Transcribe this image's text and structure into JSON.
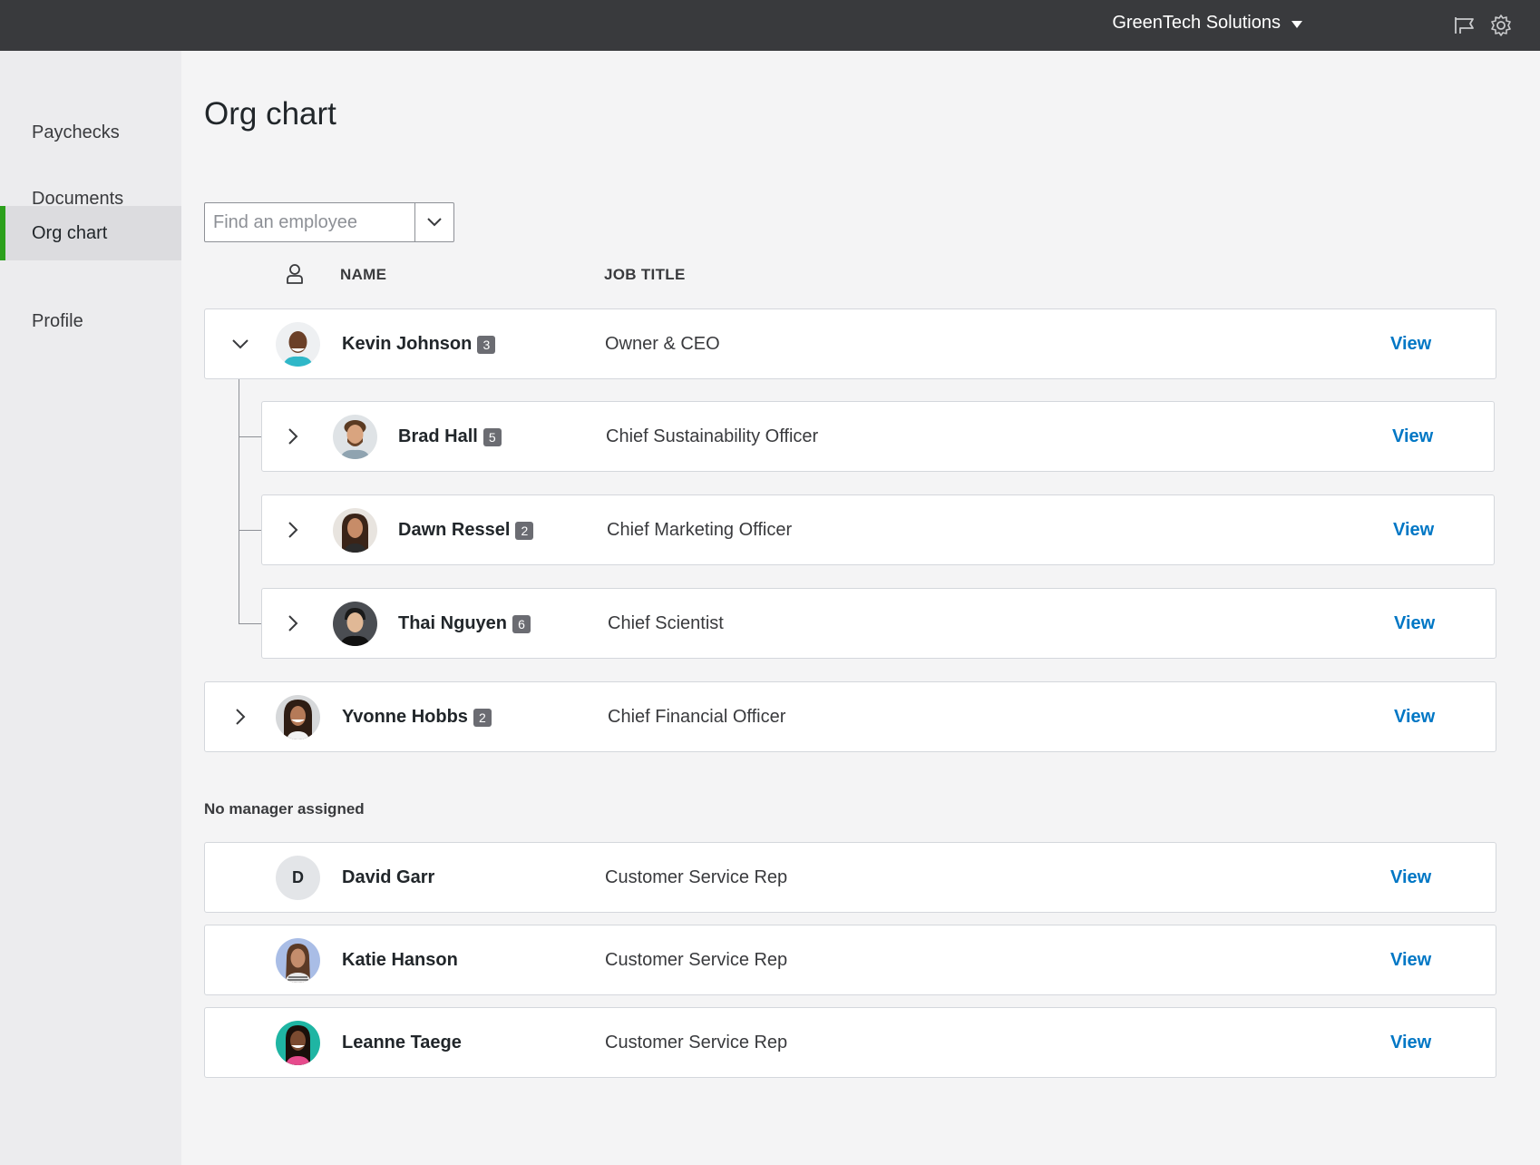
{
  "header": {
    "company_name": "GreenTech Solutions",
    "icons": [
      "megaphone-icon",
      "gear-icon"
    ]
  },
  "sidebar": {
    "items": [
      {
        "label": "Paychecks",
        "active": false
      },
      {
        "label": "Documents",
        "active": false
      },
      {
        "label": "Org chart",
        "active": true
      },
      {
        "label": "Profile",
        "active": false
      }
    ]
  },
  "main": {
    "title": "Org chart",
    "search": {
      "placeholder": "Find an employee",
      "value": ""
    },
    "columns": {
      "name": "NAME",
      "job_title": "JOB TITLE"
    },
    "view_label": "View",
    "hierarchy": [
      {
        "name": "Kevin Johnson",
        "count": "3",
        "job_title": "Owner & CEO",
        "expanded": true
      },
      {
        "name": "Brad Hall",
        "count": "5",
        "job_title": "Chief Sustainability Officer",
        "expanded": false
      },
      {
        "name": "Dawn Ressel",
        "count": "2",
        "job_title": "Chief Marketing Officer",
        "expanded": false
      },
      {
        "name": "Thai Nguyen",
        "count": "6",
        "job_title": "Chief Scientist",
        "expanded": false
      },
      {
        "name": "Yvonne Hobbs",
        "count": "2",
        "job_title": "Chief Financial Officer",
        "expanded": false
      }
    ],
    "no_manager_label": "No manager assigned",
    "unassigned": [
      {
        "name": "David Garr",
        "initial": "D",
        "job_title": "Customer Service Rep"
      },
      {
        "name": "Katie Hanson",
        "job_title": "Customer Service Rep"
      },
      {
        "name": "Leanne Taege",
        "job_title": "Customer Service Rep"
      }
    ]
  },
  "colors": {
    "topbar": "#393a3d",
    "accent_green": "#2ca01c",
    "link_blue": "#0077c5",
    "badge": "#6b6c72"
  }
}
